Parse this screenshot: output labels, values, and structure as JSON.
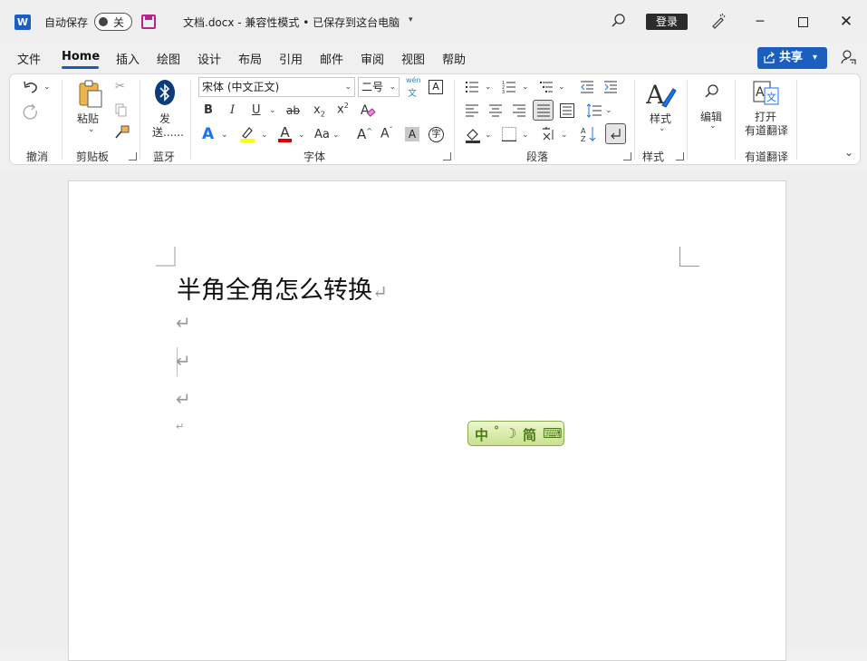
{
  "titlebar": {
    "app_icon": "word-logo-icon",
    "app_letter": "W",
    "autosave_label": "自动保存",
    "autosave_state": "关",
    "document_title": "文档.docx  -  兼容性模式 • 已保存到这台电脑",
    "login_label": "登录"
  },
  "tabs": [
    "文件",
    "Home",
    "插入",
    "绘图",
    "设计",
    "布局",
    "引用",
    "邮件",
    "审阅",
    "视图",
    "帮助"
  ],
  "active_tab": "Home",
  "share": {
    "label": "共享"
  },
  "ribbon": {
    "groups": {
      "undo": "撤消",
      "clipboard": "剪贴板",
      "bluetooth": "蓝牙",
      "font": "字体",
      "paragraph": "段落",
      "styles": "样式",
      "translate": "有道翻译"
    },
    "paste_label": "粘贴",
    "send_label_1": "发",
    "send_label_2": "送......",
    "font_name": "宋体 (中文正文)",
    "font_size": "二号",
    "phonetic_top": "wén",
    "phonetic_bottom": "文",
    "bold": "B",
    "italic": "I",
    "underline": "U",
    "strike": "ab",
    "subscript": "x",
    "superscript": "x",
    "change_case": "Aa",
    "styles_label": "样式",
    "edit_label": "编辑",
    "translate_label_1": "打开",
    "translate_label_2": "有道翻译"
  },
  "document": {
    "heading": "半角全角怎么转换",
    "ime_bar": [
      "中",
      "°",
      "☽",
      "简",
      "⌨"
    ]
  },
  "colors": {
    "accent": "#185abd",
    "highlight": "#ffff00",
    "font_color": "#e00000",
    "brand_purple": "#b4248a"
  }
}
